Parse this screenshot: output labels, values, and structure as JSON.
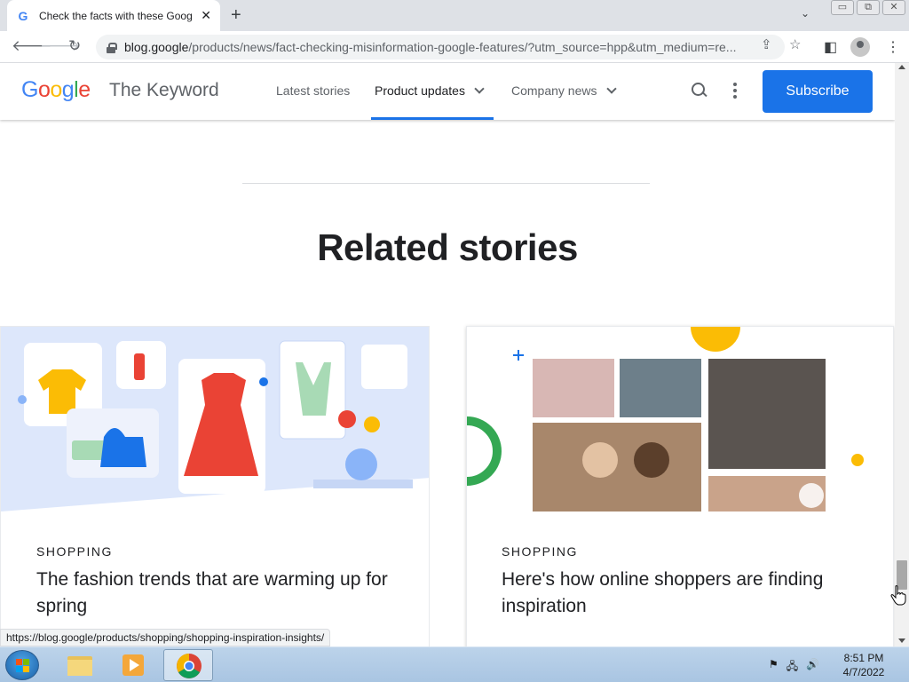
{
  "browser": {
    "tab_title": "Check the facts with these Google features",
    "tab_favicon": "G",
    "tab_close": "✕",
    "new_tab": "+",
    "tab_search": "⌄",
    "window_controls": [
      "▭",
      "⧉",
      "✕"
    ],
    "url_domain": "blog.google",
    "url_path": "/products/news/fact-checking-misinformation-google-features/?utm_source=hpp&utm_medium=re..."
  },
  "site": {
    "logo_letters": [
      {
        "ch": "G",
        "color": "#4285f4"
      },
      {
        "ch": "o",
        "color": "#ea4335"
      },
      {
        "ch": "o",
        "color": "#fbbc05"
      },
      {
        "ch": "g",
        "color": "#4285f4"
      },
      {
        "ch": "l",
        "color": "#34a853"
      },
      {
        "ch": "e",
        "color": "#ea4335"
      }
    ],
    "brand": "The Keyword",
    "nav": {
      "latest": "Latest stories",
      "product_updates": "Product updates",
      "company_news": "Company news"
    },
    "subscribe": "Subscribe",
    "accent": "#1a73e8"
  },
  "main": {
    "related_heading": "Related stories",
    "cards": [
      {
        "category": "SHOPPING",
        "title": "The fashion trends that are warming up for spring"
      },
      {
        "category": "SHOPPING",
        "title": "Here's how online shoppers are finding inspiration"
      }
    ]
  },
  "status_url": "https://blog.google/products/shopping/shopping-inspiration-insights/",
  "taskbar": {
    "time": "8:51 PM",
    "date": "4/7/2022"
  }
}
